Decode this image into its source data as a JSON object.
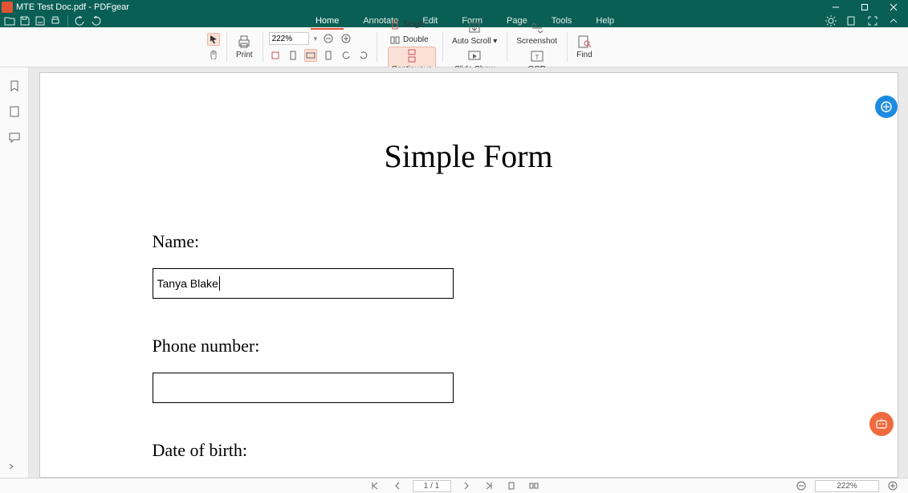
{
  "window": {
    "title": "MTE Test Doc.pdf - PDFgear"
  },
  "menu": {
    "tabs": [
      "Home",
      "Annotate",
      "Edit",
      "Form",
      "Page",
      "Tools",
      "Help"
    ],
    "active": "Home"
  },
  "ribbon": {
    "print": "Print",
    "zoom_value": "222%",
    "view_modes": {
      "single": "Single",
      "double": "Double",
      "continuous": "Continuous"
    },
    "autoscroll": "Auto Scroll",
    "slideshow": "Slide Show",
    "screenshot": "Screenshot",
    "ocr": "OCR",
    "find": "Find"
  },
  "document": {
    "title": "Simple Form",
    "labels": {
      "name": "Name:",
      "phone": "Phone number:",
      "dob": "Date of birth:"
    },
    "fields": {
      "name": "Tanya Blake",
      "phone": "",
      "dob": ""
    }
  },
  "statusbar": {
    "page_current": "1",
    "page_total": "1",
    "zoom": "222%"
  }
}
